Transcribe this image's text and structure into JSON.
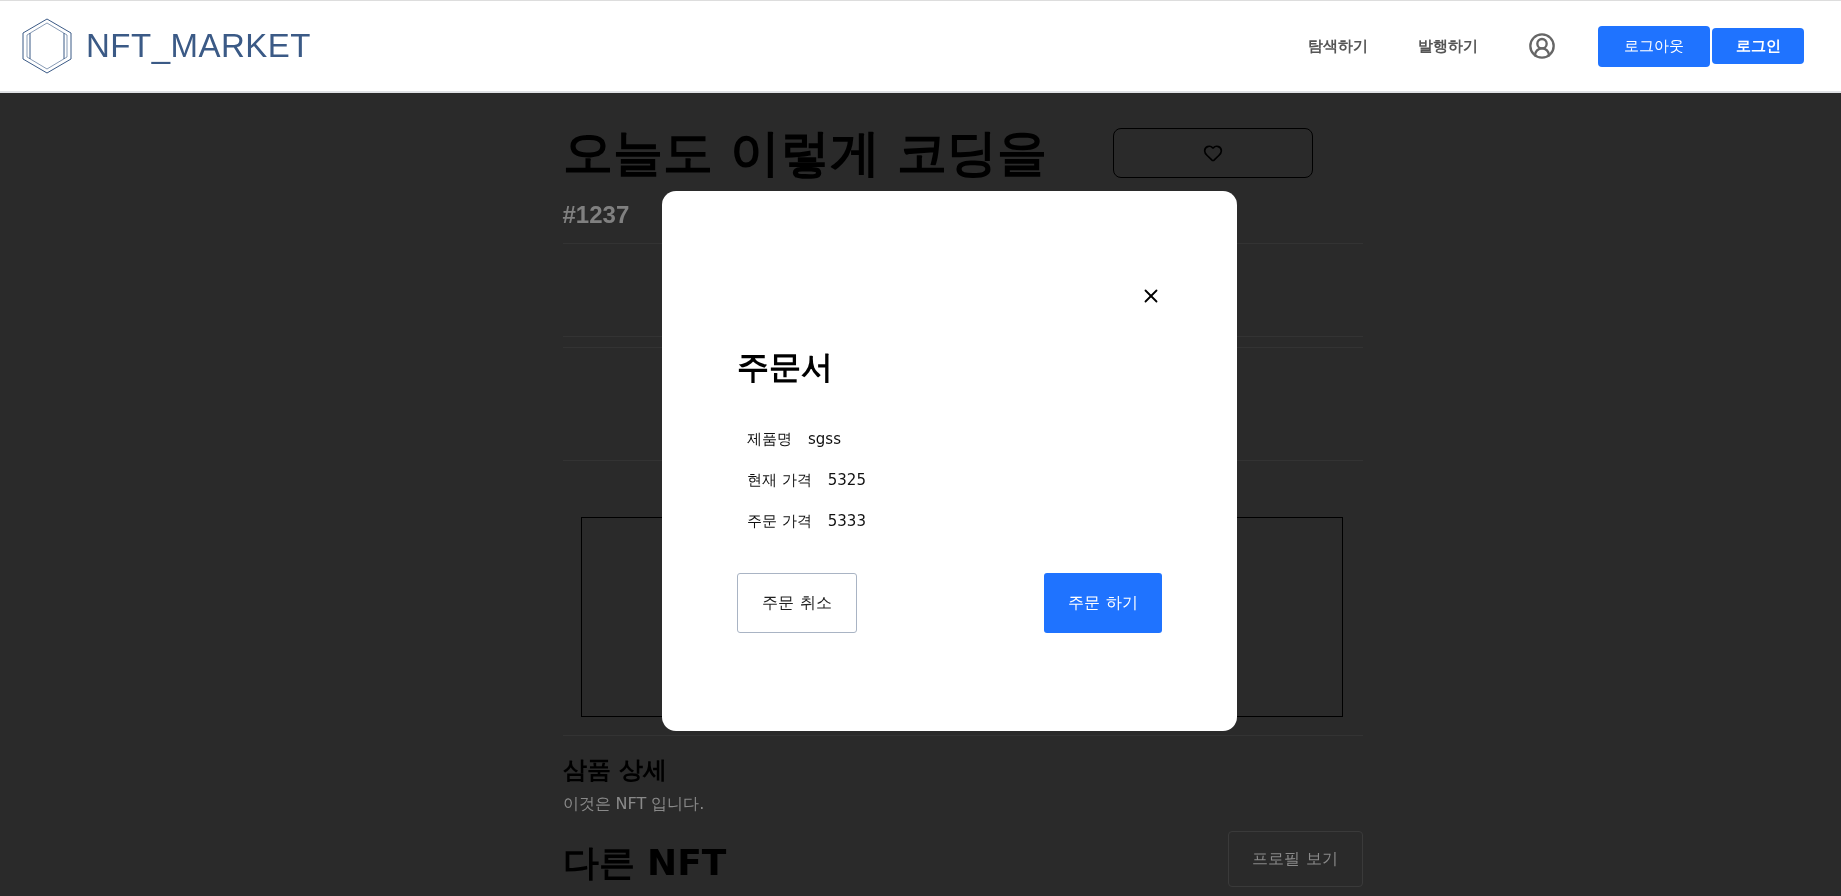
{
  "header": {
    "logo": "NFT_MARKET",
    "nav": [
      "탐색하기",
      "발행하기"
    ],
    "logout_button": "로그아웃",
    "login_button": "로그인"
  },
  "product": {
    "title": "오늘도 이렇게 코딩을",
    "token_id": "#1237",
    "detail_heading": "삼품 상세",
    "description": "이것은 NFT 입니다.",
    "other_heading": "다른 NFT",
    "profile_button": "프로필 보기"
  },
  "order_modal": {
    "title": "주문서",
    "rows": [
      {
        "label": "제품명",
        "value": "sgss"
      },
      {
        "label": "현재 가격",
        "value": "5325"
      },
      {
        "label": "주문 가격",
        "value": "5333"
      }
    ],
    "cancel_button": "주문 취소",
    "confirm_button": "주문 하기"
  }
}
